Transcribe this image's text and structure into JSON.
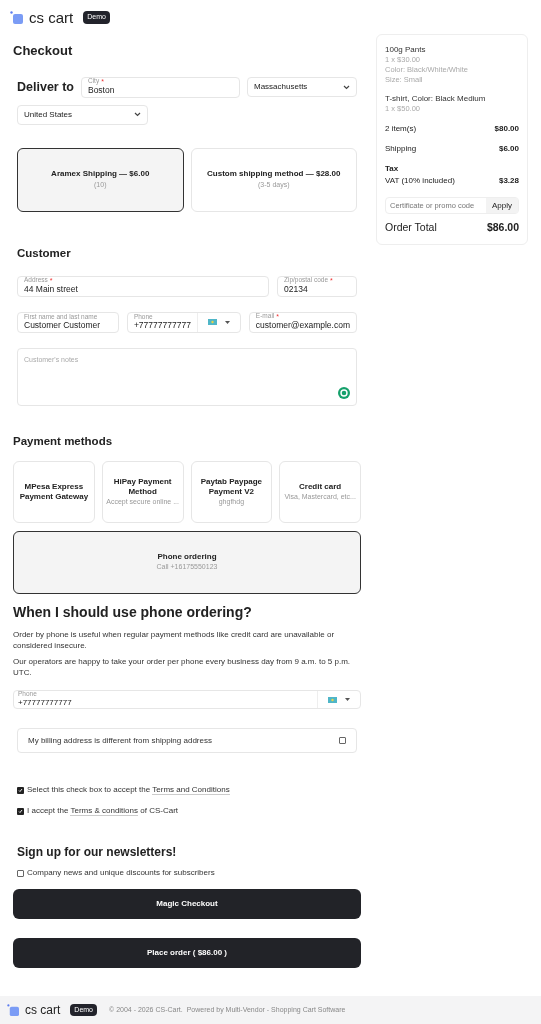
{
  "header": {
    "logo": "cs cart",
    "badge": "Demo"
  },
  "title": "Checkout",
  "deliver": {
    "heading": "Deliver to",
    "city": {
      "label": "City",
      "mark": "*",
      "value": "Boston"
    },
    "state": "Massachusetts",
    "country": "United States"
  },
  "shipping_methods": [
    {
      "name": "Aramex Shipping — $6.00",
      "detail": "(10)",
      "selected": true
    },
    {
      "name": "Custom shipping method — $28.00",
      "detail": "(3-5 days)",
      "selected": false
    }
  ],
  "customer": {
    "heading": "Customer",
    "address": {
      "label": "Address",
      "mark": "*",
      "value": "44 Main street"
    },
    "zip": {
      "label": "Zip/postal code",
      "mark": "*",
      "value": "02134"
    },
    "name": {
      "label": "First name and last name",
      "value": "Customer Customer"
    },
    "phone": {
      "label": "Phone",
      "value": "+77777777777"
    },
    "email": {
      "label": "E-mail",
      "mark": "*",
      "value": "customer@example.com"
    },
    "notes": {
      "placeholder": "Customer's notes"
    }
  },
  "payment": {
    "heading": "Payment methods",
    "methods": [
      {
        "name": "MPesa Express Payment Gateway",
        "selected": false
      },
      {
        "name": "HiPay Payment Method",
        "description": "Accept secure online ...",
        "selected": false
      },
      {
        "name": "Paytab Paypage Payment V2",
        "description": "ghgfhdg",
        "selected": false
      },
      {
        "name": "Credit card",
        "description": "Visa, Mastercard, etc...",
        "selected": false
      },
      {
        "name": "Phone ordering",
        "description": "Call +16175550123",
        "selected": true
      }
    ]
  },
  "info": {
    "heading": "When I should use phone ordering?",
    "paragraphs": [
      "Order by phone is useful when regular payment methods like credit card are unavailable or considered insecure.",
      "Our operators are happy to take your order per phone every business day from 9 a.m. to 5 p.m. UTC."
    ],
    "phone": {
      "label": "Phone",
      "value": "+77777777777"
    }
  },
  "billing": {
    "label": "My billing address is different from shipping address",
    "checked": false
  },
  "terms": [
    {
      "before": "Select this check box to accept the",
      "link": "Terms and Conditions",
      "checked": true
    },
    {
      "before": "I accept the",
      "link": "Terms & conditions",
      "after": "of CS-Cart",
      "checked": true
    }
  ],
  "newsletter": {
    "heading": "Sign up for our newsletters!",
    "label": "Company news and unique discounts for subscribers",
    "checked": false
  },
  "buttons": [
    "Magic Checkout",
    "Place order ( $86.00 )"
  ],
  "summary": {
    "products": [
      {
        "name": "100g Pants",
        "details": [
          "1 x $30.00",
          "Color: Black/White/White",
          "Size: Small"
        ]
      },
      {
        "name": "T-shirt, Color: Black Medium",
        "details": [
          "1 x $50.00"
        ]
      }
    ],
    "totals": [
      {
        "label": "2 item(s)",
        "value": "$80.00"
      },
      {
        "label": "Shipping",
        "value": "$6.00"
      }
    ],
    "tax": {
      "heading": "Tax",
      "label": "VAT (10% included)",
      "value": "$3.28"
    },
    "promo": {
      "placeholder": "Certificate or promo code",
      "button": "Apply"
    },
    "total": {
      "label": "Order Total",
      "value": "$86.00"
    }
  },
  "footer": {
    "logo": "cs cart",
    "badge": "Demo",
    "copyright": "© 2004 - 2026 CS-Cart.",
    "powered": "Powered by Multi-Vendor - Shopping Cart Software"
  }
}
